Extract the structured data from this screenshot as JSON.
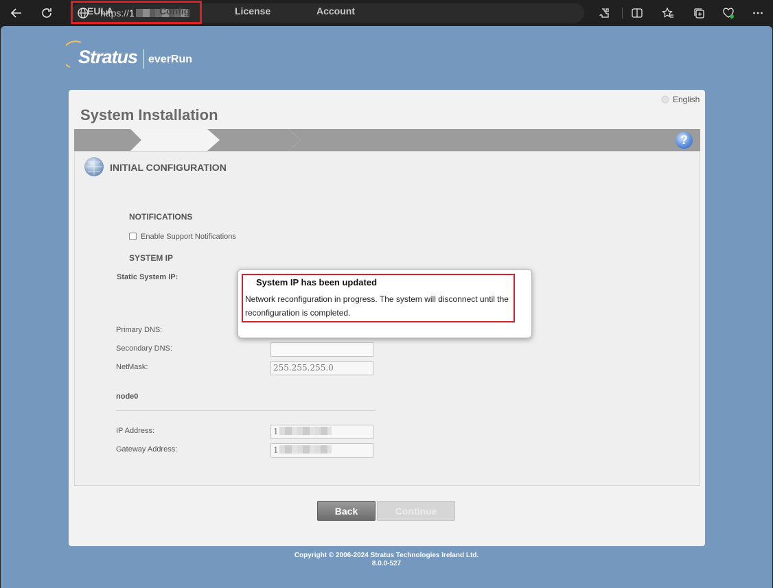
{
  "browser": {
    "url_prefix": "https://",
    "url_visible": "1",
    "icons": [
      "back-arrow-icon",
      "refresh-icon",
      "globe-icon",
      "extensions-icon",
      "split-screen-icon",
      "favorites-icon",
      "collections-icon",
      "browser-essentials-icon",
      "more-icon"
    ]
  },
  "brand": {
    "name": "Stratus",
    "product": "everRun"
  },
  "header": {
    "language": "English",
    "title": "System Installation"
  },
  "steps": [
    {
      "label": "EULA",
      "state": "done"
    },
    {
      "label": "Config",
      "state": "active"
    },
    {
      "label": "License",
      "state": "pending"
    },
    {
      "label": "Account",
      "state": "pending"
    }
  ],
  "help_label": "?",
  "section": {
    "title": "INITIAL CONFIGURATION",
    "notifications_heading": "NOTIFICATIONS",
    "enable_support_label": "Enable Support Notifications",
    "system_ip_heading": "SYSTEM IP",
    "static_ip_label": "Static System IP:",
    "primary_dns_label": "Primary DNS:",
    "secondary_dns_label": "Secondary DNS:",
    "netmask_label": "NetMask:",
    "netmask_value": "255.255.255.0",
    "node_heading": "node0",
    "ip_address_label": "IP Address:",
    "ip_address_value": "1",
    "gateway_label": "Gateway Address:",
    "gateway_value": "1"
  },
  "buttons": {
    "back": "Back",
    "continue": "Continue"
  },
  "footer": {
    "copyright": "Copyright © 2006-2024 Stratus Technologies Ireland Ltd.",
    "version": "8.0.0-527"
  },
  "dialog": {
    "title": "System IP has been updated",
    "message": "Network reconfiguration in progress. The system will disconnect until the reconfiguration is completed."
  },
  "colors": {
    "page_bg": "#7598bf",
    "highlight": "#e02020"
  }
}
